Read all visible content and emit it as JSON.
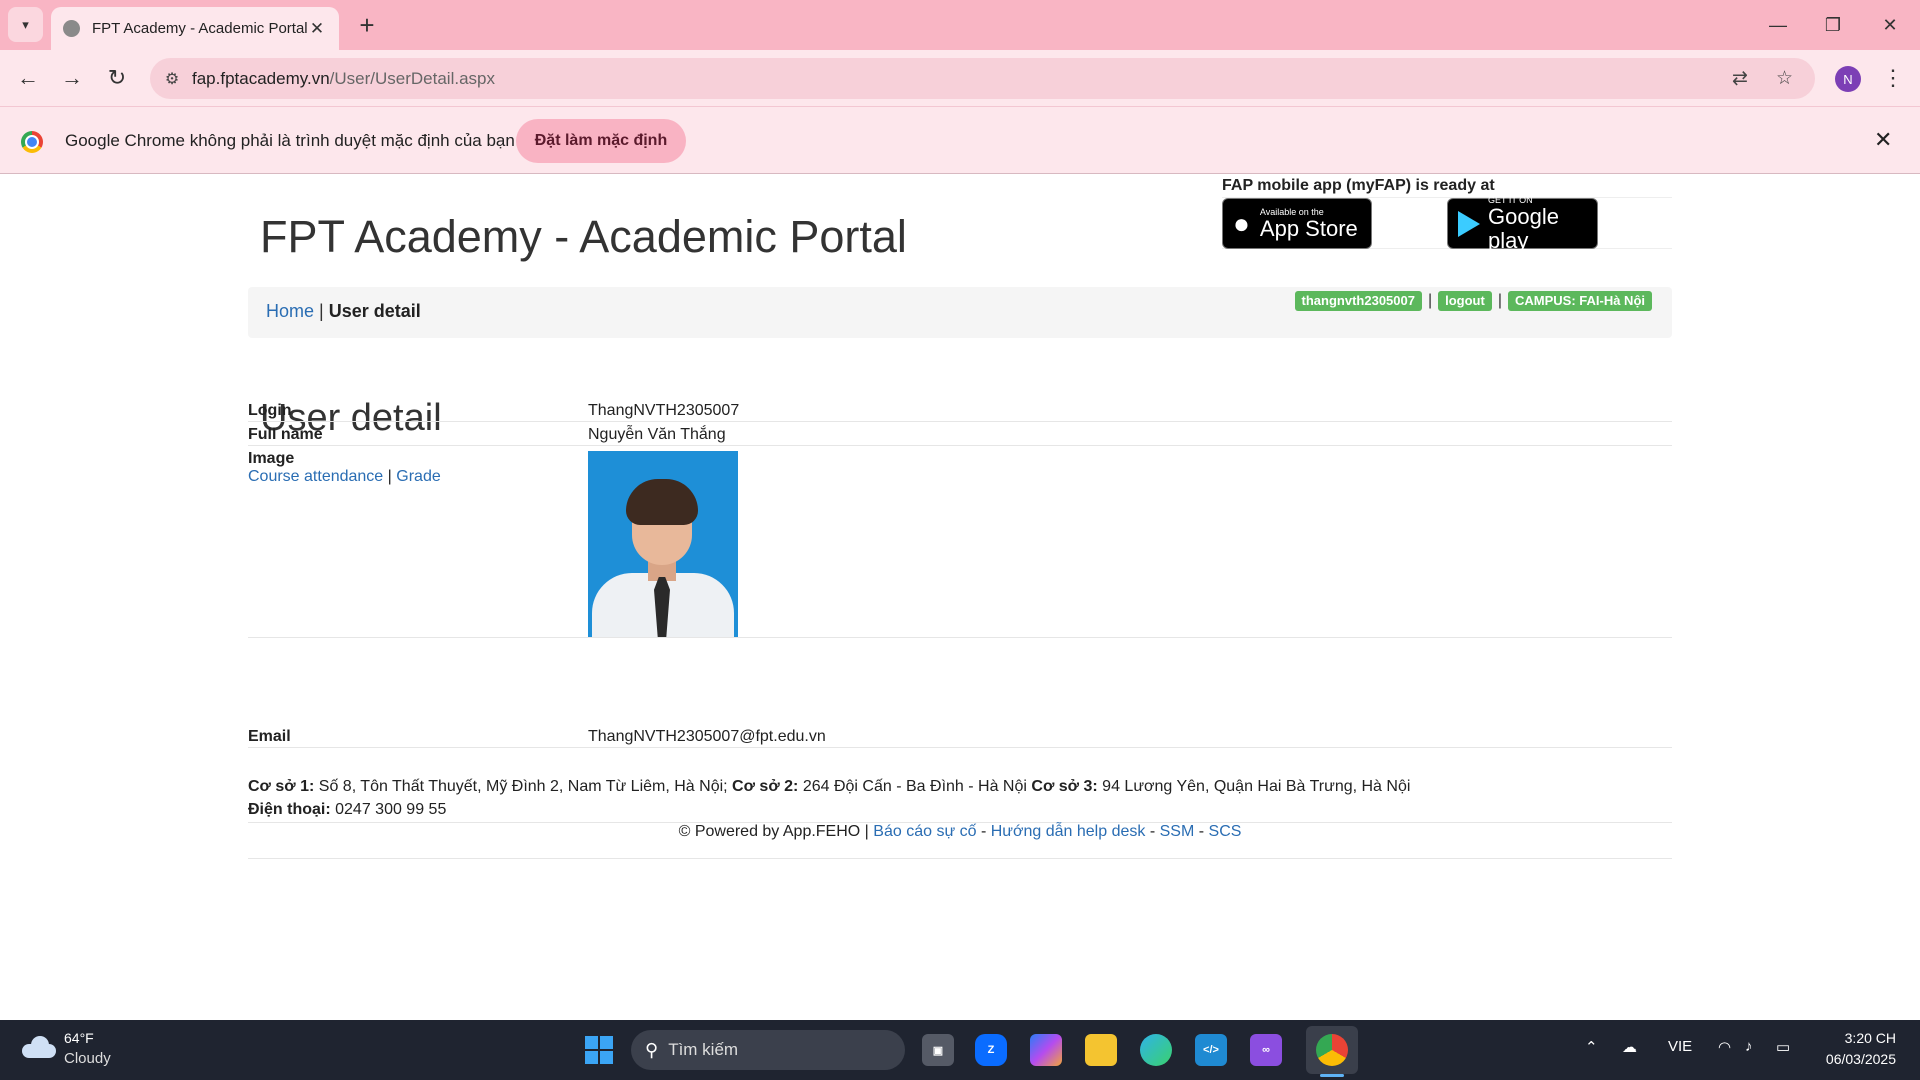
{
  "browser": {
    "tab_title": "FPT Academy - Academic Portal",
    "url_domain": "fap.fptacademy.vn",
    "url_path": "/User/UserDetail.aspx",
    "profile_initial": "N",
    "infobar_text": "Google Chrome không phải là trình duyệt mặc định của bạn",
    "infobar_button": "Đặt làm mặc định"
  },
  "header": {
    "mobile_title": "FAP mobile app (myFAP) is ready at",
    "appstore_small": "Available on the",
    "appstore_big": "App Store",
    "googleplay_small": "GET IT ON",
    "googleplay_big": "Google play",
    "portal_title": "FPT Academy - Academic Portal"
  },
  "breadcrumb": {
    "home": "Home",
    "separator": "|",
    "current": "User detail"
  },
  "user_labels": {
    "username": "thangnvth2305007",
    "logout": "logout",
    "campus": "CAMPUS: FAI-Hà Nội"
  },
  "main": {
    "heading": "User detail",
    "link_attendance": "Course attendance",
    "link_separator": "|",
    "link_grade": "Grade",
    "rows": [
      {
        "key": "Login",
        "value": "ThangNVTH2305007"
      },
      {
        "key": "Full name",
        "value": "Nguyễn Văn Thắng"
      },
      {
        "key": "Image",
        "value": ""
      },
      {
        "key": "Email",
        "value": "ThangNVTH2305007@fpt.edu.vn"
      }
    ]
  },
  "footer": {
    "coso1_label": "Cơ sở 1:",
    "coso1_text": "Số 8, Tôn Thất Thuyết, Mỹ Đình 2, Nam Từ Liêm, Hà Nội;",
    "coso2_label": "Cơ sở 2:",
    "coso2_text": "264 Đội Cấn - Ba Đình - Hà Nội",
    "coso3_label": "Cơ sở 3:",
    "coso3_text": "94 Lương Yên, Quận Hai Bà Trưng, Hà Nội",
    "phone_label": "Điện thoại:",
    "phone_text": "0247 300 99 55",
    "powered": "© Powered by App.FEHO |",
    "link_report": "Báo cáo sự cố",
    "link_helpdesk": "Hướng dẫn help desk",
    "link_ssm": "SSM",
    "link_scs": "SCS",
    "dash": "-"
  },
  "taskbar": {
    "temperature": "64°F",
    "weather": "Cloudy",
    "search_placeholder": "Tìm kiếm",
    "language": "VIE",
    "time": "3:20 CH",
    "date": "06/03/2025"
  },
  "colors": {
    "tab_strip": "#f9b5c4",
    "toolbar": "#fde7ec",
    "link": "#2a6db3",
    "label_green": "#5cb85c",
    "taskbar": "#1f2430"
  }
}
